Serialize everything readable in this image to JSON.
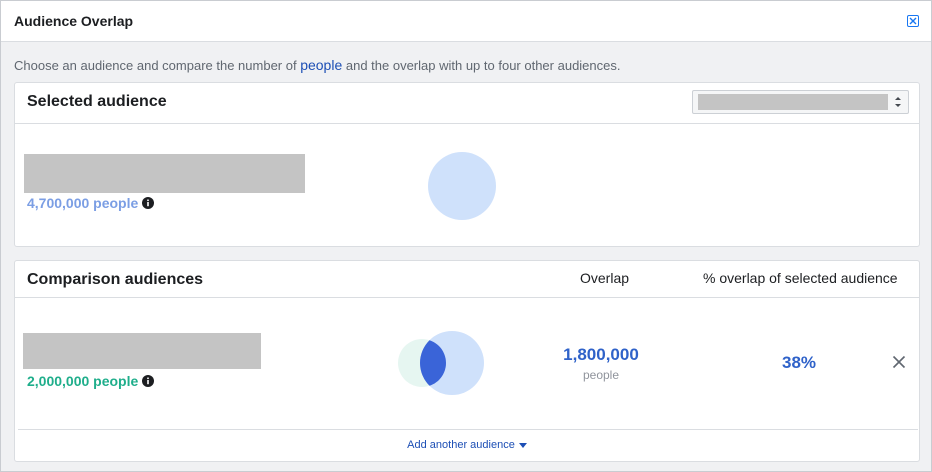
{
  "header": {
    "title": "Audience Overlap"
  },
  "description": {
    "before": "Choose an audience and compare the number of ",
    "link": "people",
    "after": " and the overlap with up to four other audiences."
  },
  "selected": {
    "title": "Selected audience",
    "dropdown_value": "",
    "people_label": "4,700,000 people"
  },
  "comparison": {
    "title": "Comparison audiences",
    "columns": {
      "overlap": "Overlap",
      "percent": "% overlap of selected audience"
    },
    "rows": [
      {
        "people_label": "2,000,000 people",
        "overlap_count": "1,800,000",
        "overlap_unit": "people",
        "overlap_percent": "38%"
      }
    ],
    "add_label": "Add another audience"
  },
  "icons": {
    "close": "close-icon",
    "info": "info-icon",
    "remove": "x-icon",
    "dropdown": "chevron-down-icon",
    "select_arrows": "updown-arrows-icon"
  },
  "colors": {
    "selected_audience": "#cfe1fb",
    "comparison_audience": "#e6f6f1",
    "overlap": "#3a64d8",
    "link": "#1d4fb5",
    "selected_count": "#7b9ee4",
    "comparison_count": "#1fae8b"
  }
}
